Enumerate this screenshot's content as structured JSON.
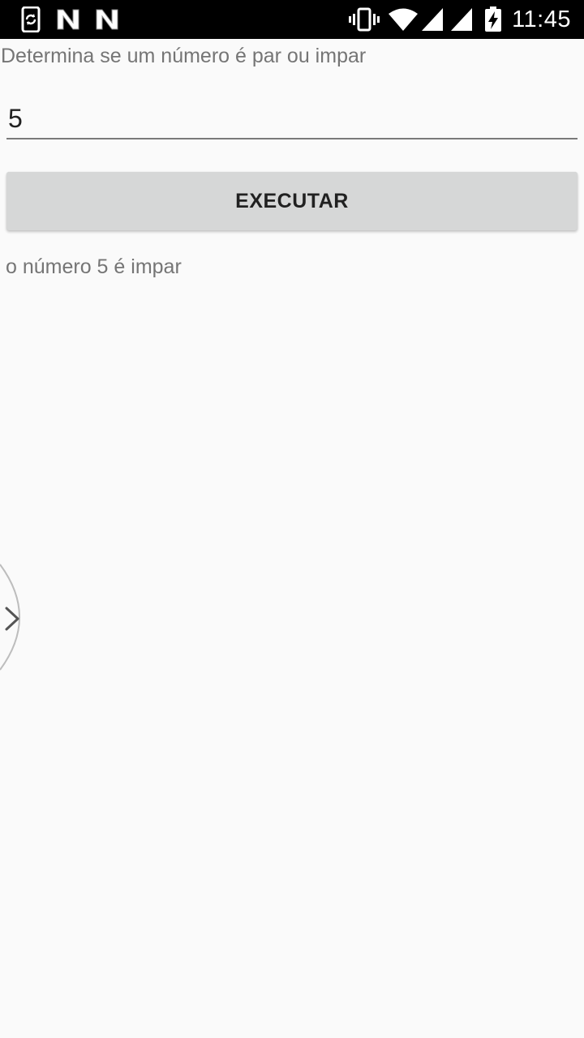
{
  "status_bar": {
    "time": "11:45",
    "icons": [
      "phone-sync-icon",
      "n-notification-icon",
      "n-notification-icon",
      "vibrate-icon",
      "wifi-icon",
      "signal-icon",
      "signal-icon",
      "battery-charging-icon"
    ]
  },
  "main": {
    "header": "Determina se um número é par ou impar",
    "input_value": "5",
    "execute_button": "EXECUTAR",
    "result": "o número 5 é impar"
  },
  "colors": {
    "status_bar_bg": "#000000",
    "background": "#fafafa",
    "button_bg": "#d6d7d7",
    "secondary_text": "#757575",
    "primary_text": "#212121"
  }
}
